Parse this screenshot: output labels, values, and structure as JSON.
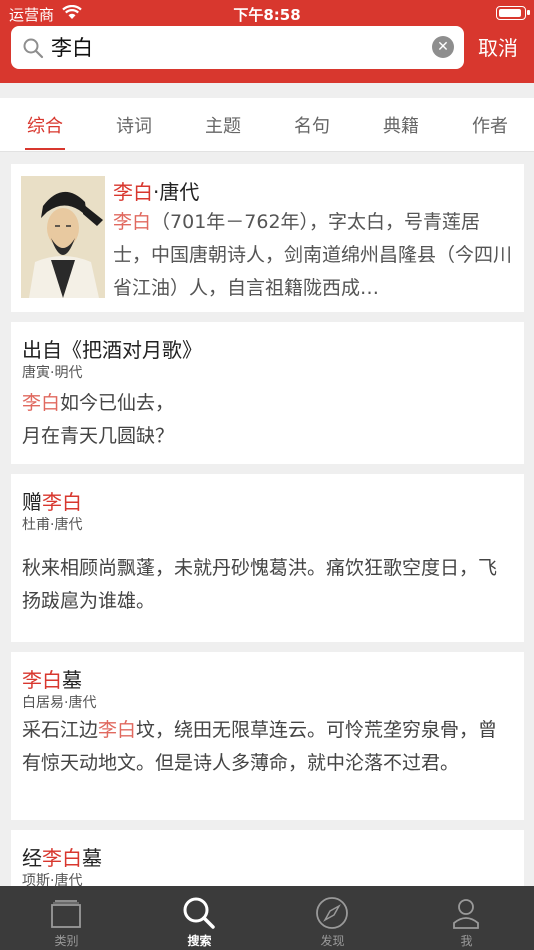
{
  "status_bar": {
    "carrier": "运营商",
    "time": "下午8:58"
  },
  "search": {
    "query": "李白",
    "placeholder": "",
    "cancel_label": "取消"
  },
  "tabs": [
    {
      "label": "综合",
      "active": true
    },
    {
      "label": "诗词",
      "active": false
    },
    {
      "label": "主题",
      "active": false
    },
    {
      "label": "名句",
      "active": false
    },
    {
      "label": "典籍",
      "active": false
    },
    {
      "label": "作者",
      "active": false
    }
  ],
  "author_card": {
    "name": "李白",
    "dynasty_suffix": "·唐代",
    "desc_highlight": "李白",
    "desc_rest": "（701年－762年），字太白，号青莲居士，中国唐朝诗人，剑南道绵州昌隆县（今四川省江油）人，自言祖籍陇西成…"
  },
  "results": [
    {
      "title_pre": "出自《把酒对月歌》",
      "title_hl": "",
      "title_post": "",
      "author": "唐寅·明代",
      "line1_hl": "李白",
      "line1_rest": "如今已仙去，",
      "line2": "月在青天几圆缺？"
    },
    {
      "title_pre": "赠",
      "title_hl": "李白",
      "title_post": "",
      "author": "杜甫·唐代",
      "text": "秋来相顾尚飘蓬，未就丹砂愧葛洪。痛饮狂歌空度日，飞扬跋扈为谁雄。"
    },
    {
      "title_pre": "",
      "title_hl": "李白",
      "title_post": "墓",
      "author": "白居易·唐代",
      "text_pre": "采石江边",
      "text_hl": "李白",
      "text_post": "坟，绕田无限草连云。可怜荒垄穷泉骨，曾有惊天动地文。但是诗人多薄命，就中沦落不过君。"
    },
    {
      "title_pre": "经",
      "title_hl": "李白",
      "title_post": "墓",
      "author": "项斯·唐代"
    }
  ],
  "tabbar": [
    {
      "label": "类别",
      "icon": "category-icon",
      "active": false
    },
    {
      "label": "搜索",
      "icon": "search-icon",
      "active": true
    },
    {
      "label": "发现",
      "icon": "compass-icon",
      "active": false
    },
    {
      "label": "我",
      "icon": "person-icon",
      "active": false
    }
  ],
  "colors": {
    "brand_red": "#d8372e",
    "tabbar_bg": "#3b3b3b",
    "page_bg": "#efefef"
  }
}
